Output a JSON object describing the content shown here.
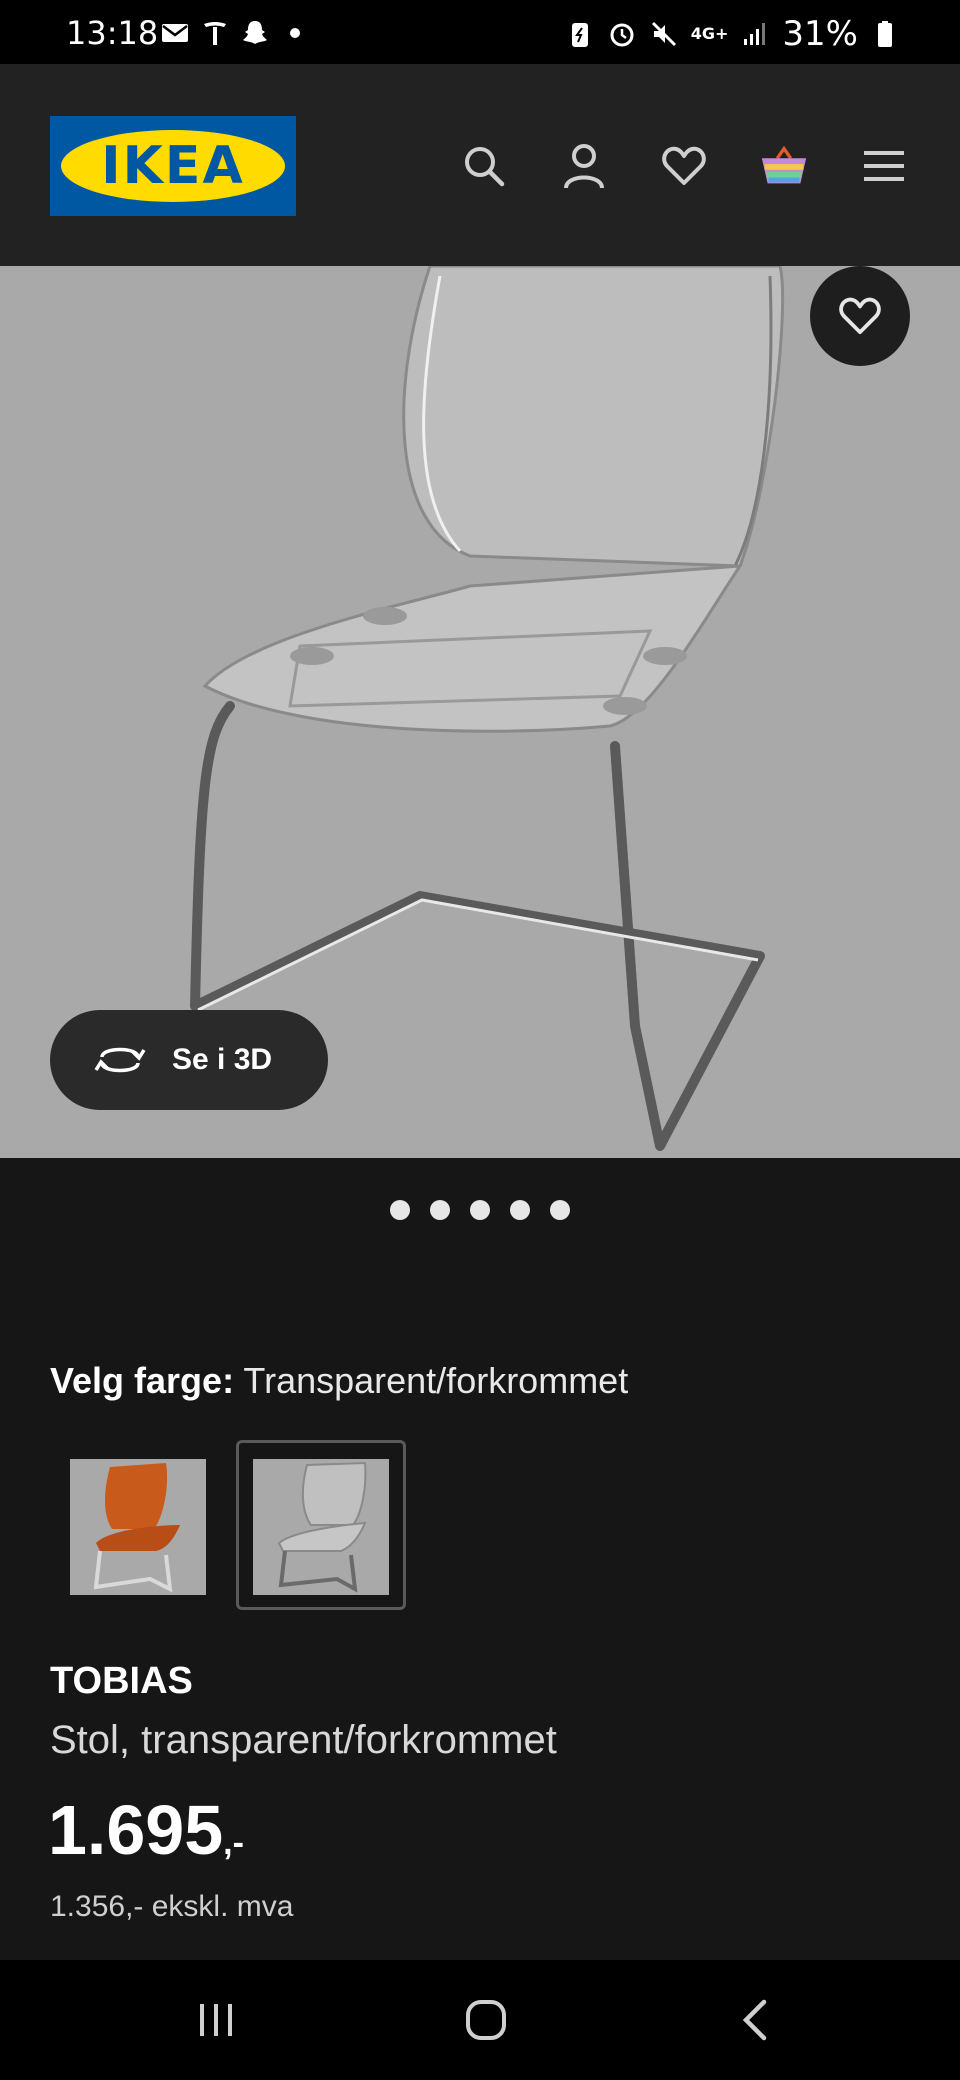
{
  "status_bar": {
    "time": "13:18",
    "battery_percent": "31%",
    "network": "4G+"
  },
  "header": {
    "logo_text": "IKEA",
    "icons": [
      "search-icon",
      "account-icon",
      "favorites-icon",
      "cart-icon",
      "menu-icon"
    ]
  },
  "product_image": {
    "view_3d_label": "Se i 3D",
    "carousel_count": 5
  },
  "color_selection": {
    "label": "Velg farge:",
    "value": "Transparent/forkrommet",
    "swatches": [
      "orange",
      "transparent"
    ],
    "selected_index": 1
  },
  "product": {
    "name": "TOBIAS",
    "description": "Stol, transparent/forkrommet",
    "price": "1.695",
    "price_suffix": ",-",
    "price_ex_vat": "1.356,- ekskl. mva"
  },
  "colors": {
    "background": "#161616",
    "header": "#222222",
    "image_bg": "#a9a9a9",
    "ikea_blue": "#0058a3",
    "ikea_yellow": "#ffdb00"
  }
}
